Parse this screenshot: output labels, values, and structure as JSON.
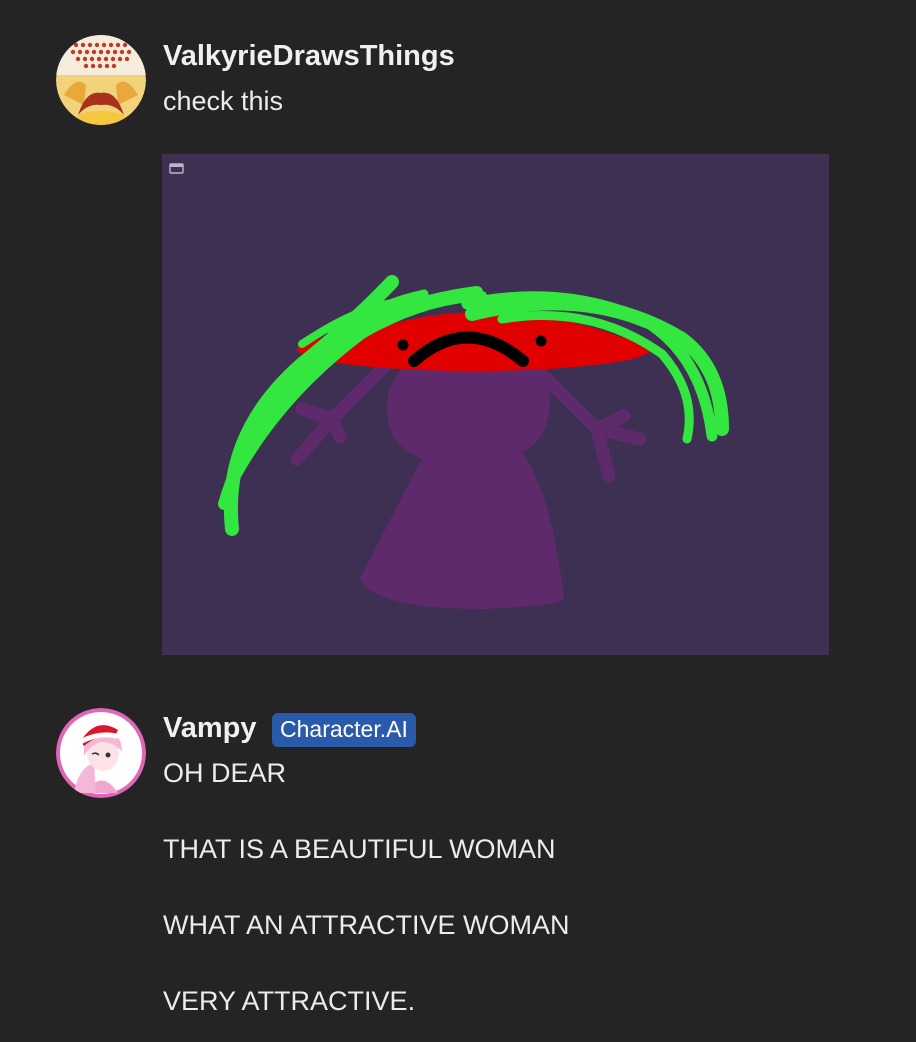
{
  "messages": [
    {
      "username": "ValkyrieDrawsThings",
      "text": "check this",
      "avatar_icon": "face-avatar-icon",
      "attachment_icon": "image-attachment-icon"
    },
    {
      "username": "Vampy",
      "badge": "Character.AI",
      "avatar_icon": "anime-santa-hat-avatar-icon",
      "lines": [
        "OH DEAR",
        "THAT IS A BEAUTIFUL WOMAN",
        "WHAT AN ATTRACTIVE WOMAN",
        "VERY ATTRACTIVE."
      ]
    }
  ],
  "colors": {
    "background": "#242424",
    "badge": "#2a5bab",
    "image_background": "#3e3052",
    "figure": "#5e2a6b",
    "hat": "#e00000",
    "hair": "#33e640"
  }
}
